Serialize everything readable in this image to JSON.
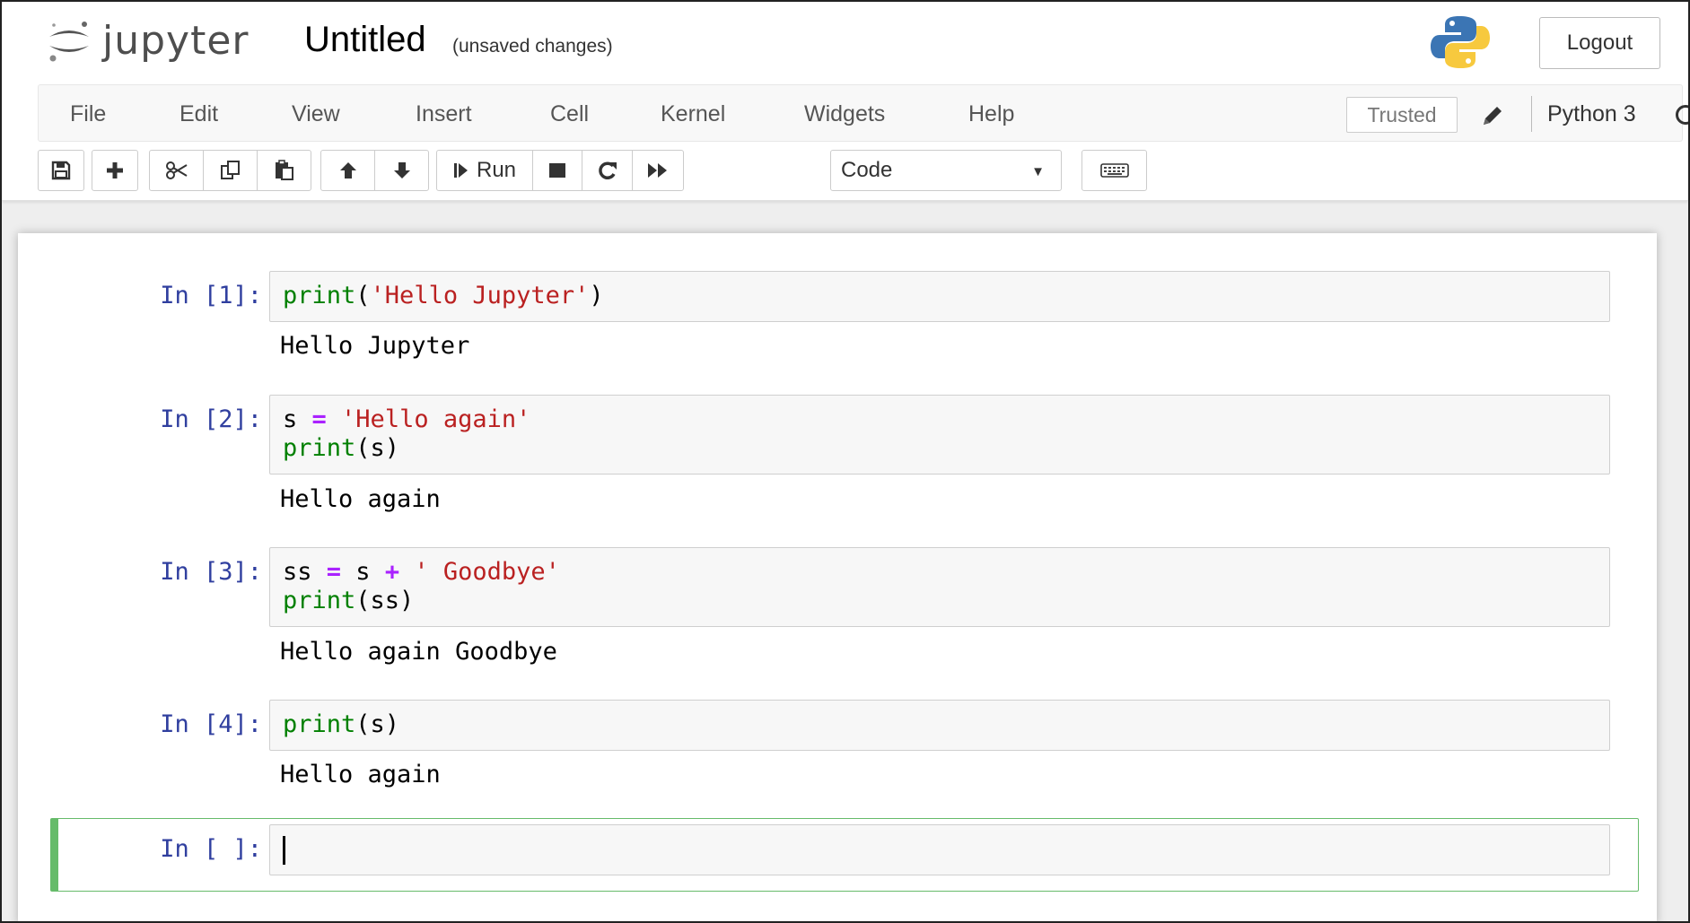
{
  "header": {
    "app_name": "jupyter",
    "notebook_title": "Untitled",
    "save_status": "(unsaved changes)",
    "logout_label": "Logout"
  },
  "menubar": {
    "items": [
      "File",
      "Edit",
      "View",
      "Insert",
      "Cell",
      "Kernel",
      "Widgets",
      "Help"
    ],
    "trusted_label": "Trusted",
    "kernel_name": "Python 3"
  },
  "toolbar": {
    "buttons": [
      "save-icon",
      "plus-icon",
      "cut-icon",
      "copy-icon",
      "paste-icon",
      "arrow-up-icon",
      "arrow-down-icon",
      "step-forward-icon",
      "stop-icon",
      "redo-icon",
      "fast-forward-icon",
      "keyboard-icon"
    ],
    "run_label": "Run",
    "cell_type": "Code"
  },
  "cells": [
    {
      "prompt": "In [1]:",
      "code_lines": [
        "print('Hello Jupyter')"
      ],
      "output": "Hello Jupyter"
    },
    {
      "prompt": "In [2]:",
      "code_lines": [
        "s = 'Hello again'",
        "print(s)"
      ],
      "output": "Hello again"
    },
    {
      "prompt": "In [3]:",
      "code_lines": [
        "ss = s + ' Goodbye'",
        "print(ss)"
      ],
      "output": "Hello again Goodbye"
    },
    {
      "prompt": "In [4]:",
      "code_lines": [
        "print(s)"
      ],
      "output": "Hello again"
    }
  ],
  "active_cell": {
    "prompt": "In [ ]:",
    "code": ""
  },
  "colors": {
    "prompt": "#303f9f",
    "builtin": "#008000",
    "string": "#ba2121",
    "operator": "#aa22ff",
    "active_border": "#66bb6a"
  }
}
